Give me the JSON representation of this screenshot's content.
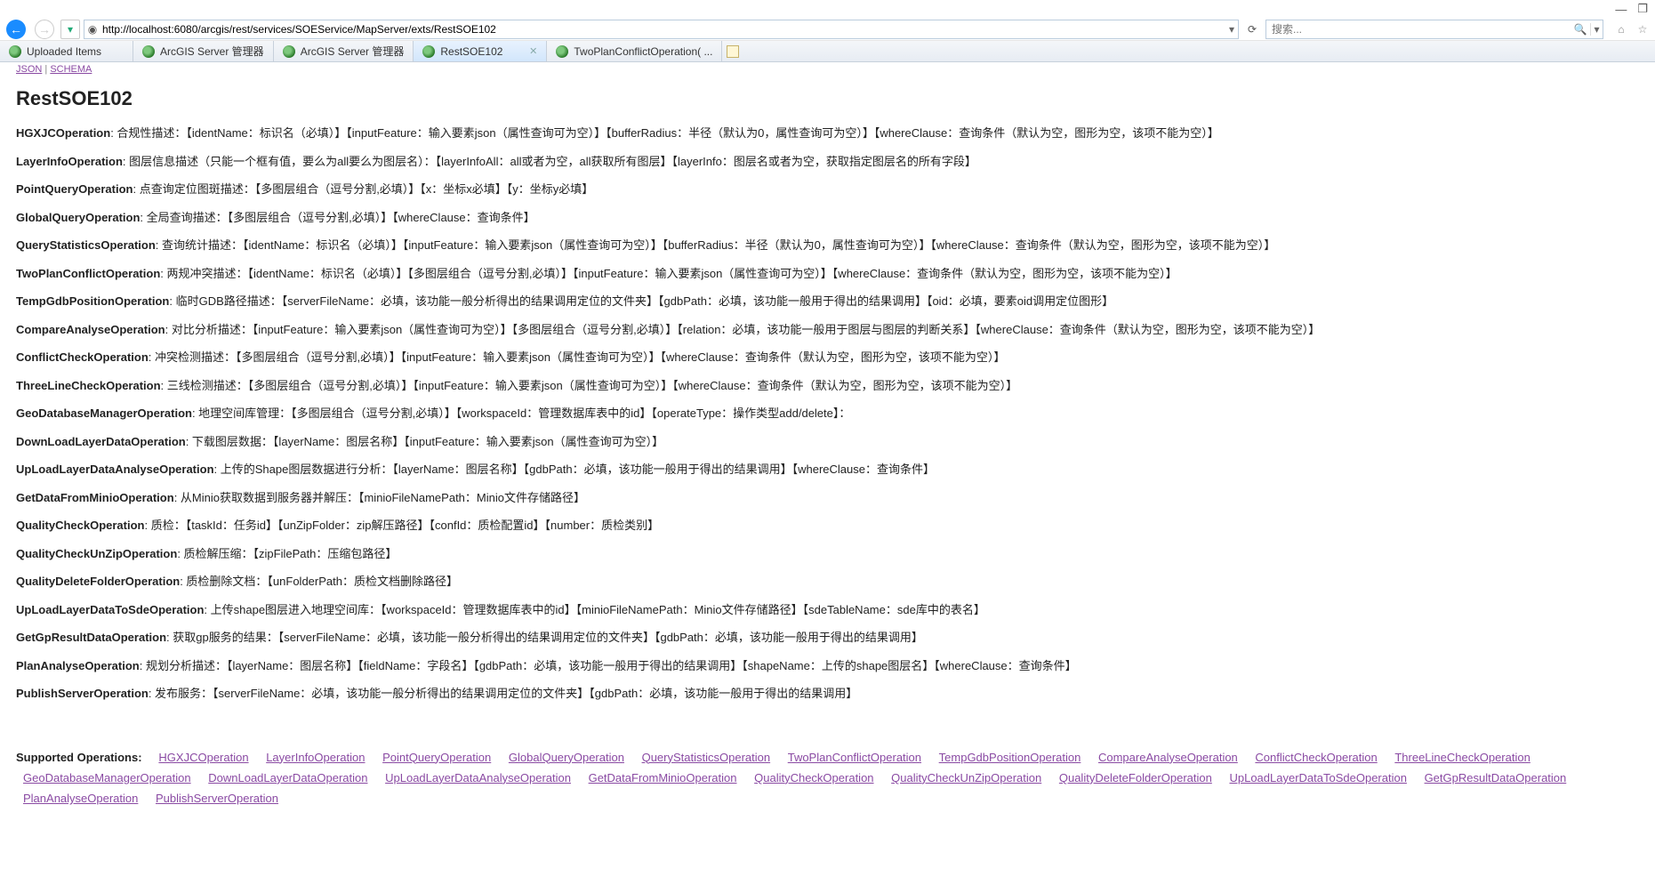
{
  "window": {
    "minimize": "—",
    "maximize": "❐",
    "close": ""
  },
  "nav": {
    "url": "http://localhost:6080/arcgis/rest/services/SOEService/MapServer/exts/RestSOE102",
    "search_placeholder": "搜索..."
  },
  "tabs": [
    {
      "label": "Uploaded Items",
      "icon": "earth"
    },
    {
      "label": "ArcGIS Server 管理器",
      "icon": "earth"
    },
    {
      "label": "ArcGIS Server 管理器",
      "icon": "earth"
    },
    {
      "label": "RestSOE102",
      "icon": "earth",
      "active": true
    },
    {
      "label": "TwoPlanConflictOperation( ...",
      "icon": "earth"
    }
  ],
  "toplinks": {
    "json": "JSON",
    "schema": "SCHEMA"
  },
  "title": "RestSOE102",
  "ops": [
    {
      "name": "HGXJCOperation",
      "text": ": 合规性描述：【identName：标识名（必填）】【inputFeature：输入要素json（属性查询可为空）】【bufferRadius：半径（默认为0，属性查询可为空）】【whereClause：查询条件（默认为空，图形为空，该项不能为空）】"
    },
    {
      "name": "LayerInfoOperation",
      "text": ": 图层信息描述（只能一个框有值，要么为all要么为图层名）：【layerInfoAll：all或者为空，all获取所有图层】【layerInfo：图层名或者为空，获取指定图层名的所有字段】"
    },
    {
      "name": "PointQueryOperation",
      "text": ": 点查询定位图斑描述：【多图层组合（逗号分割,必填）】【x：坐标x必填】【y：坐标y必填】"
    },
    {
      "name": "GlobalQueryOperation",
      "text": ": 全局查询描述：【多图层组合（逗号分割,必填）】【whereClause：查询条件】"
    },
    {
      "name": "QueryStatisticsOperation",
      "text": ": 查询统计描述：【identName：标识名（必填）】【inputFeature：输入要素json（属性查询可为空）】【bufferRadius：半径（默认为0，属性查询可为空）】【whereClause：查询条件（默认为空，图形为空，该项不能为空）】"
    },
    {
      "name": "TwoPlanConflictOperation",
      "text": ": 两规冲突描述：【identName：标识名（必填）】【多图层组合（逗号分割,必填）】【inputFeature：输入要素json（属性查询可为空）】【whereClause：查询条件（默认为空，图形为空，该项不能为空）】"
    },
    {
      "name": "TempGdbPositionOperation",
      "text": ": 临时GDB路径描述：【serverFileName：必填，该功能一般分析得出的结果调用定位的文件夹】【gdbPath：必填，该功能一般用于得出的结果调用】【oid：必填，要素oid调用定位图形】"
    },
    {
      "name": "CompareAnalyseOperation",
      "text": ": 对比分析描述：【inputFeature：输入要素json（属性查询可为空）】【多图层组合（逗号分割,必填）】【relation：必填，该功能一般用于图层与图层的判断关系】【whereClause：查询条件（默认为空，图形为空，该项不能为空）】"
    },
    {
      "name": "ConflictCheckOperation",
      "text": ": 冲突检测描述：【多图层组合（逗号分割,必填）】【inputFeature：输入要素json（属性查询可为空）】【whereClause：查询条件（默认为空，图形为空，该项不能为空）】"
    },
    {
      "name": "ThreeLineCheckOperation",
      "text": ": 三线检测描述：【多图层组合（逗号分割,必填）】【inputFeature：输入要素json（属性查询可为空）】【whereClause：查询条件（默认为空，图形为空，该项不能为空）】"
    },
    {
      "name": "GeoDatabaseManagerOperation",
      "text": ": 地理空间库管理：【多图层组合（逗号分割,必填）】【workspaceId：管理数据库表中的id】【operateType：操作类型add/delete】："
    },
    {
      "name": "DownLoadLayerDataOperation",
      "text": ": 下载图层数据：【layerName：图层名称】【inputFeature：输入要素json（属性查询可为空）】"
    },
    {
      "name": "UpLoadLayerDataAnalyseOperation",
      "text": ": 上传的Shape图层数据进行分析：【layerName：图层名称】【gdbPath：必填，该功能一般用于得出的结果调用】【whereClause：查询条件】"
    },
    {
      "name": "GetDataFromMinioOperation",
      "text": ": 从Minio获取数据到服务器并解压：【minioFileNamePath：Minio文件存储路径】"
    },
    {
      "name": "QualityCheckOperation",
      "text": ": 质检：【taskId：任务id】【unZipFolder：zip解压路径】【confId：质检配置id】【number：质检类别】"
    },
    {
      "name": "QualityCheckUnZipOperation",
      "text": ": 质检解压缩：【zipFilePath：压缩包路径】"
    },
    {
      "name": "QualityDeleteFolderOperation",
      "text": ": 质检删除文档：【unFolderPath：质检文档删除路径】"
    },
    {
      "name": "UpLoadLayerDataToSdeOperation",
      "text": ": 上传shape图层进入地理空间库：【workspaceId：管理数据库表中的id】【minioFileNamePath：Minio文件存储路径】【sdeTableName：sde库中的表名】"
    },
    {
      "name": "GetGpResultDataOperation",
      "text": ": 获取gp服务的结果：【serverFileName：必填，该功能一般分析得出的结果调用定位的文件夹】【gdbPath：必填，该功能一般用于得出的结果调用】"
    },
    {
      "name": "PlanAnalyseOperation",
      "text": ": 规划分析描述：【layerName：图层名称】【fieldName：字段名】【gdbPath：必填，该功能一般用于得出的结果调用】【shapeName：上传的shape图层名】【whereClause：查询条件】"
    },
    {
      "name": "PublishServerOperation",
      "text": ": 发布服务：【serverFileName：必填，该功能一般分析得出的结果调用定位的文件夹】【gdbPath：必填，该功能一般用于得出的结果调用】"
    }
  ],
  "footer": {
    "label": "Supported Operations:",
    "links": [
      "HGXJCOperation",
      "LayerInfoOperation",
      "PointQueryOperation",
      "GlobalQueryOperation",
      "QueryStatisticsOperation",
      "TwoPlanConflictOperation",
      "TempGdbPositionOperation",
      "CompareAnalyseOperation",
      "ConflictCheckOperation",
      "ThreeLineCheckOperation",
      "GeoDatabaseManagerOperation",
      "DownLoadLayerDataOperation",
      "UpLoadLayerDataAnalyseOperation",
      "GetDataFromMinioOperation",
      "QualityCheckOperation",
      "QualityCheckUnZipOperation",
      "QualityDeleteFolderOperation",
      "UpLoadLayerDataToSdeOperation",
      "GetGpResultDataOperation",
      "PlanAnalyseOperation",
      "PublishServerOperation"
    ]
  }
}
